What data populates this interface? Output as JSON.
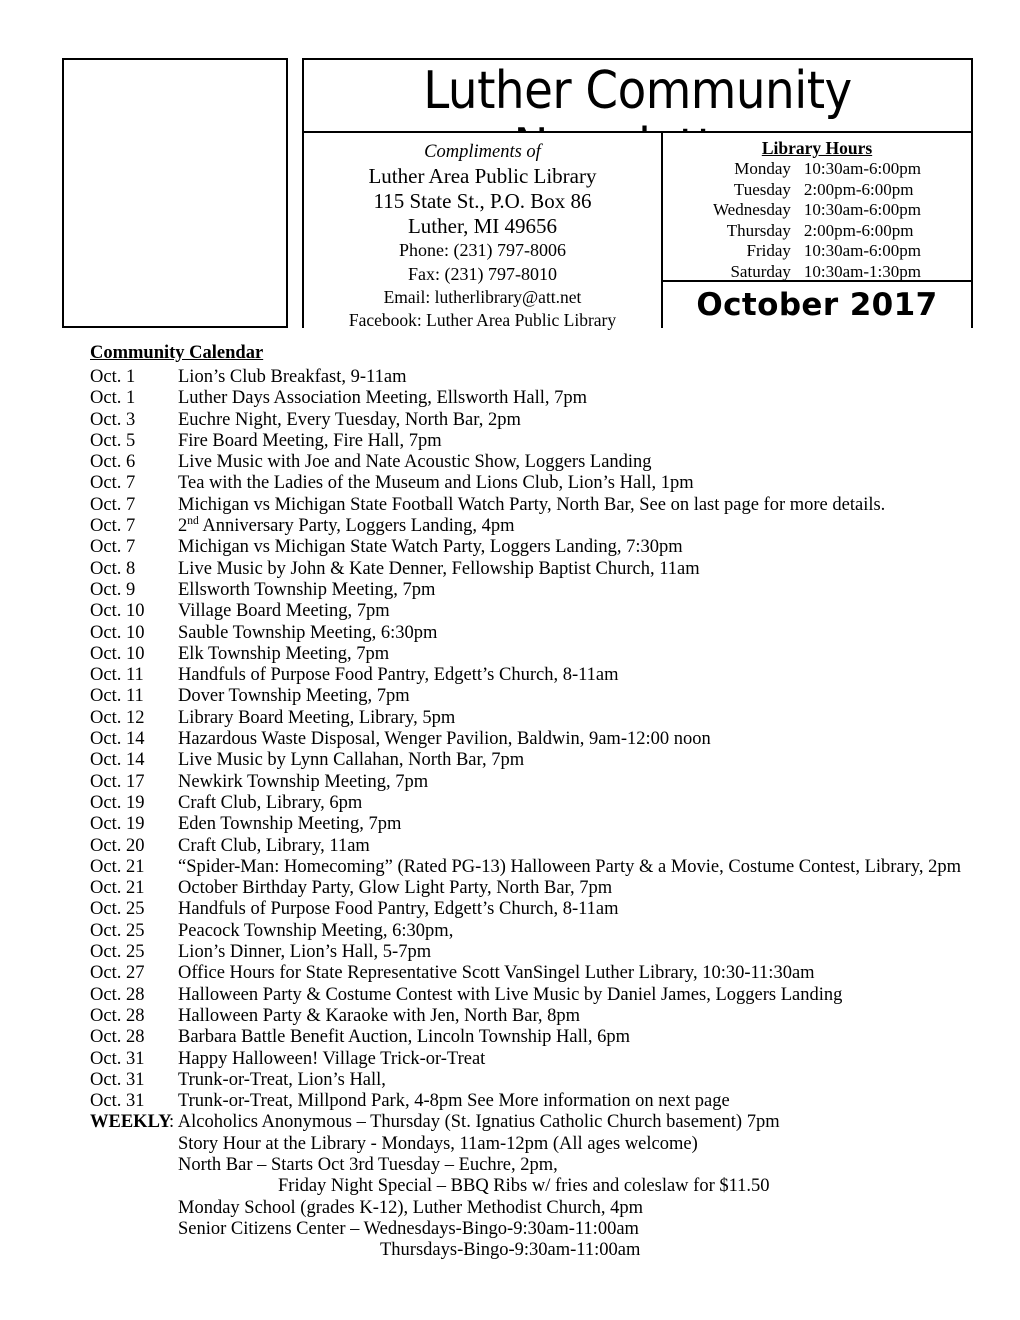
{
  "masthead": {
    "title": "Luther Community Newsletter",
    "logo_box_label": "",
    "contact": {
      "compliments": "Compliments of",
      "organization": "Luther Area Public Library",
      "address": "115 State St., P.O. Box 86",
      "city_state_zip": "Luther, MI 49656",
      "phone": "Phone: (231) 797-8006",
      "fax": "Fax: (231) 797-8010",
      "email": "Email: lutherlibrary@att.net",
      "facebook": "Facebook:  Luther Area Public Library"
    },
    "hours": {
      "heading": "Library Hours",
      "rows": [
        {
          "day": "Monday",
          "time": "10:30am-6:00pm"
        },
        {
          "day": "Tuesday",
          "time": "2:00pm-6:00pm"
        },
        {
          "day": "Wednesday",
          "time": "10:30am-6:00pm"
        },
        {
          "day": "Thursday",
          "time": "2:00pm-6:00pm"
        },
        {
          "day": "Friday",
          "time": "10:30am-6:00pm"
        },
        {
          "day": "Saturday",
          "time": "10:30am-1:30pm"
        }
      ]
    },
    "month_banner": "October 2017"
  },
  "calendar": {
    "heading": "Community Calendar",
    "events": [
      {
        "date": "Oct. 1",
        "desc": "Lion’s Club Breakfast, 9-11am"
      },
      {
        "date": "Oct. 1",
        "desc": "Luther Days Association Meeting, Ellsworth Hall, 7pm"
      },
      {
        "date": "Oct. 3",
        "desc": "Euchre Night, Every Tuesday, North Bar, 2pm"
      },
      {
        "date": "Oct. 5",
        "desc": "Fire Board Meeting, Fire Hall, 7pm"
      },
      {
        "date": "Oct. 6",
        "desc": "Live Music with Joe and Nate Acoustic Show, Loggers Landing"
      },
      {
        "date": "Oct. 7",
        "desc": "Tea with the Ladies of the Museum and Lions Club, Lion’s Hall, 1pm"
      },
      {
        "date": "Oct. 7",
        "desc": "Michigan vs Michigan State Football Watch Party, North Bar, See on last page for more details."
      },
      {
        "date": "Oct. 7",
        "desc": "2nd Anniversary Party, Loggers Landing, 4pm",
        "sup": {
          "before": "2",
          "sup": "nd",
          "after": " Anniversary Party, Loggers Landing, 4pm"
        }
      },
      {
        "date": "Oct. 7",
        "desc": "Michigan vs Michigan State Watch Party, Loggers Landing, 7:30pm"
      },
      {
        "date": "Oct. 8",
        "desc": "Live Music by John & Kate Denner, Fellowship Baptist Church, 11am"
      },
      {
        "date": "Oct. 9",
        "desc": "Ellsworth Township Meeting, 7pm"
      },
      {
        "date": "Oct. 10",
        "desc": "Village Board Meeting, 7pm"
      },
      {
        "date": "Oct. 10",
        "desc": "Sauble Township Meeting, 6:30pm"
      },
      {
        "date": "Oct. 10",
        "desc": "Elk Township Meeting, 7pm"
      },
      {
        "date": "Oct. 11",
        "desc": "Handfuls of Purpose Food Pantry, Edgett’s Church, 8-11am"
      },
      {
        "date": "Oct. 11",
        "desc": "Dover Township Meeting, 7pm"
      },
      {
        "date": "Oct. 12",
        "desc": "Library Board Meeting, Library, 5pm"
      },
      {
        "date": "Oct. 14",
        "desc": "Hazardous Waste Disposal, Wenger Pavilion, Baldwin, 9am-12:00 noon"
      },
      {
        "date": "Oct. 14",
        "desc": "Live Music by Lynn Callahan, North Bar, 7pm"
      },
      {
        "date": "Oct. 17",
        "desc": "Newkirk Township Meeting, 7pm"
      },
      {
        "date": "Oct. 19",
        "desc": "Craft Club, Library, 6pm"
      },
      {
        "date": "Oct. 19",
        "desc": "Eden Township Meeting, 7pm"
      },
      {
        "date": "Oct. 20",
        "desc": "Craft Club, Library, 11am"
      },
      {
        "date": "Oct. 21",
        "desc": "“Spider-Man: Homecoming” (Rated PG-13) Halloween Party & a Movie, Costume Contest, Library, 2pm"
      },
      {
        "date": "Oct. 21",
        "desc": "October Birthday Party, Glow Light Party, North Bar, 7pm"
      },
      {
        "date": "Oct. 25",
        "desc": "Handfuls of Purpose Food Pantry, Edgett’s Church, 8-11am"
      },
      {
        "date": "Oct. 25",
        "desc": "Peacock Township Meeting, 6:30pm,"
      },
      {
        "date": "Oct. 25",
        "desc": "Lion’s Dinner, Lion’s Hall, 5-7pm"
      },
      {
        "date": "Oct. 27",
        "desc": "Office Hours for State Representative Scott VanSingel Luther Library, 10:30-11:30am"
      },
      {
        "date": "Oct. 28",
        "desc": "Halloween Party & Costume Contest with Live Music by Daniel James, Loggers Landing"
      },
      {
        "date": "Oct. 28",
        "desc": "Halloween Party & Karaoke with Jen, North Bar, 8pm"
      },
      {
        "date": "Oct. 28",
        "desc": "Barbara Battle Benefit Auction, Lincoln Township Hall, 6pm"
      },
      {
        "date": "Oct. 31",
        "desc": "Happy Halloween! Village Trick-or-Treat"
      },
      {
        "date": "Oct. 31",
        "desc": "Trunk-or-Treat, Lion’s Hall,"
      },
      {
        "date": "Oct. 31",
        "desc": "Trunk-or-Treat, Millpond Park, 4-8pm See More information on next page"
      }
    ],
    "weekly": {
      "label": "WEEKLY",
      "first_line": ": Alcoholics Anonymous – Thursday (St. Ignatius Catholic Church basement) 7pm",
      "lines": [
        {
          "text": "Story Hour at the Library - Mondays, 11am-12pm (All ages welcome)",
          "indent": 0
        },
        {
          "text": "North Bar – Starts Oct 3rd Tuesday – Euchre, 2pm,",
          "indent": 0
        },
        {
          "text": "Friday Night Special – BBQ Ribs w/ fries and coleslaw for $11.50",
          "indent": 1
        },
        {
          "text": "Monday School (grades K-12), Luther Methodist Church, 4pm",
          "indent": 0
        },
        {
          "text": "Senior Citizens Center – Wednesdays-Bingo-9:30am-11:00am",
          "indent": 0
        },
        {
          "text": "Thursdays-Bingo-9:30am-11:00am",
          "indent": 2
        }
      ]
    }
  }
}
